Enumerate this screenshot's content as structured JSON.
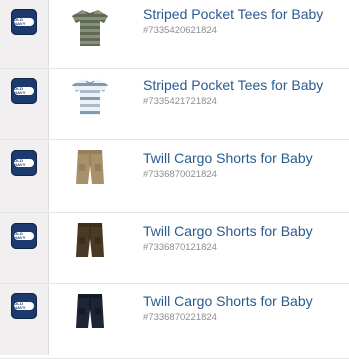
{
  "items": [
    {
      "title": "Striped Pocket Tees for Baby",
      "sku": "#7335420621824",
      "brand_badge": "OLD NAVY",
      "thumb_icon": "gray-green-striped-tee-icon"
    },
    {
      "title": "Striped Pocket Tees for Baby",
      "sku": "#7335421721824",
      "brand_badge": "OLD NAVY",
      "thumb_icon": "blue-white-striped-tee-icon"
    },
    {
      "title": "Twill Cargo Shorts for Baby",
      "sku": "#7336870021824",
      "brand_badge": "OLD NAVY",
      "thumb_icon": "khaki-shorts-icon"
    },
    {
      "title": "Twill Cargo Shorts for Baby",
      "sku": "#7336870121824",
      "brand_badge": "OLD NAVY",
      "thumb_icon": "brown-shorts-icon"
    },
    {
      "title": "Twill Cargo Shorts for Baby",
      "sku": "#7336870221824",
      "brand_badge": "OLD NAVY",
      "thumb_icon": "navy-shorts-icon"
    }
  ],
  "colors": {
    "title": "#2b5a8e",
    "sku": "#8d8d8d",
    "badge": "#1c3a6e",
    "sidebar": "#f1efef"
  }
}
